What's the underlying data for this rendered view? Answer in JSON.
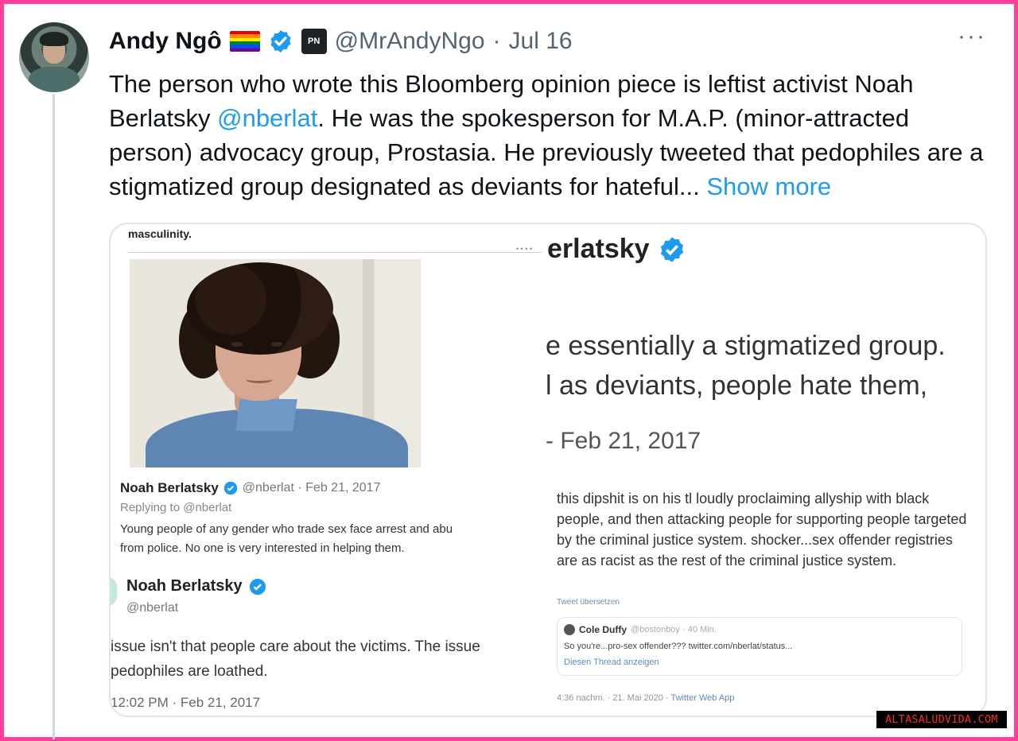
{
  "tweet": {
    "author_name": "Andy Ngô",
    "handle": "@MrAndyNgo",
    "separator": "·",
    "date": "Jul 16",
    "more_label": "···",
    "pn_badge": "PN",
    "text_part1": "The person who wrote this Bloomberg opinion piece is leftist activist Noah Berlatsky ",
    "mention": "@nberlat",
    "text_part2": ". He was the spokesperson for M.A.P. (minor-attracted person) advocacy group, Prostasia. He previously tweeted that pedophiles are a stigmatized group designated as deviants for hateful... ",
    "show_more": "Show more",
    "colors": {
      "accent": "#1d9bf0",
      "verified": "#1d9bf0",
      "frame": "#ff3d9a"
    }
  },
  "media": {
    "left": {
      "header_word": "masculinity.",
      "nav_dots": "• • • •",
      "mini_tweet": {
        "name": "Noah Berlatsky",
        "handle_date": "@nberlat · Feb 21, 2017",
        "replying_to": "Replying to @nberlat",
        "line1": "Young people of any gender who trade sex face arrest and abu",
        "line2": "from police. No one is very interested in helping them."
      },
      "big_tweet": {
        "name": "Noah Berlatsky",
        "handle": "@nberlat",
        "line1": "issue isn't that people care about the victims. The issue",
        "line2": "pedophiles are loathed.",
        "time": "12:02 PM · Feb 21, 2017"
      }
    },
    "right": {
      "zoom_name": "erlatsky",
      "zoom_line1": "e essentially a stigmatized group.",
      "zoom_line2": "l as deviants, people hate them,",
      "zoom_time": "- Feb 21, 2017",
      "reply_text": "this dipshit is on his tl loudly proclaiming allyship with black people, and then attacking people for supporting people targeted by the criminal justice system. shocker...sex offender registries are as racist as the rest of the criminal justice system.",
      "translate": "Tweet übersetzen",
      "quote": {
        "name": "Cole Duffy",
        "meta": "@bostonboy · 40 Min.",
        "body": "So you're...pro-sex offender??? twitter.com/nberlat/status...",
        "link": "Diesen Thread anzeigen"
      },
      "footer_time": "4:36 nachm. · 21. Mai 2020 · ",
      "footer_app": "Twitter Web App"
    }
  },
  "watermark": "ALTASALUDVIDA.COM"
}
